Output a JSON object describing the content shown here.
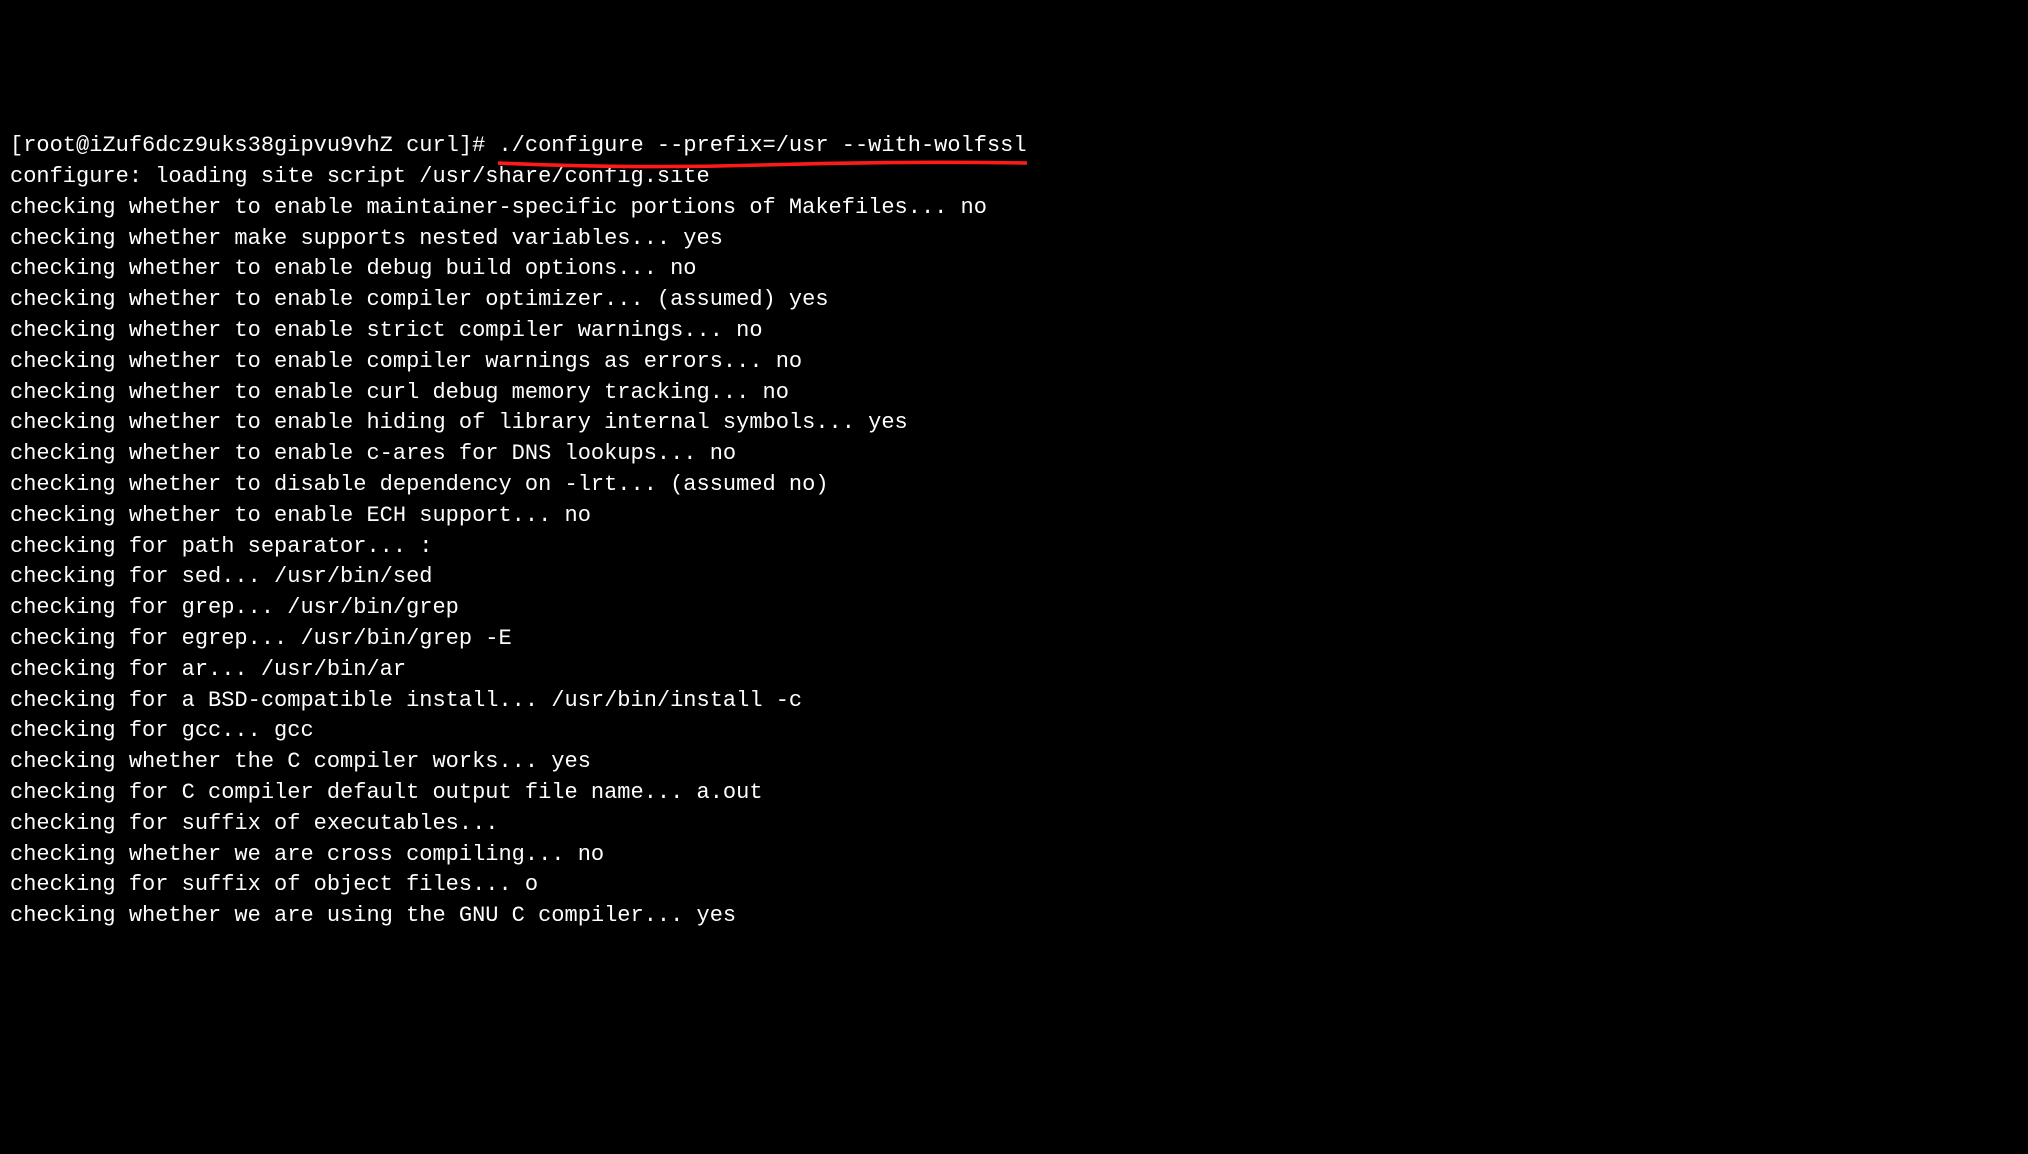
{
  "annotation": {
    "underline_color": "#ff1a1a"
  },
  "prompt": {
    "prefix": "[root@iZuf6dcz9uks38gipvu9vhZ curl]# ",
    "command": "./configure --prefix=/usr --with-wolfssl"
  },
  "lines": [
    "configure: loading site script /usr/share/config.site",
    "checking whether to enable maintainer-specific portions of Makefiles... no",
    "checking whether make supports nested variables... yes",
    "checking whether to enable debug build options... no",
    "checking whether to enable compiler optimizer... (assumed) yes",
    "checking whether to enable strict compiler warnings... no",
    "checking whether to enable compiler warnings as errors... no",
    "checking whether to enable curl debug memory tracking... no",
    "checking whether to enable hiding of library internal symbols... yes",
    "checking whether to enable c-ares for DNS lookups... no",
    "checking whether to disable dependency on -lrt... (assumed no)",
    "checking whether to enable ECH support... no",
    "checking for path separator... :",
    "checking for sed... /usr/bin/sed",
    "checking for grep... /usr/bin/grep",
    "checking for egrep... /usr/bin/grep -E",
    "checking for ar... /usr/bin/ar",
    "checking for a BSD-compatible install... /usr/bin/install -c",
    "checking for gcc... gcc",
    "checking whether the C compiler works... yes",
    "checking for C compiler default output file name... a.out",
    "checking for suffix of executables... ",
    "checking whether we are cross compiling... no",
    "checking for suffix of object files... o",
    "checking whether we are using the GNU C compiler... yes"
  ]
}
